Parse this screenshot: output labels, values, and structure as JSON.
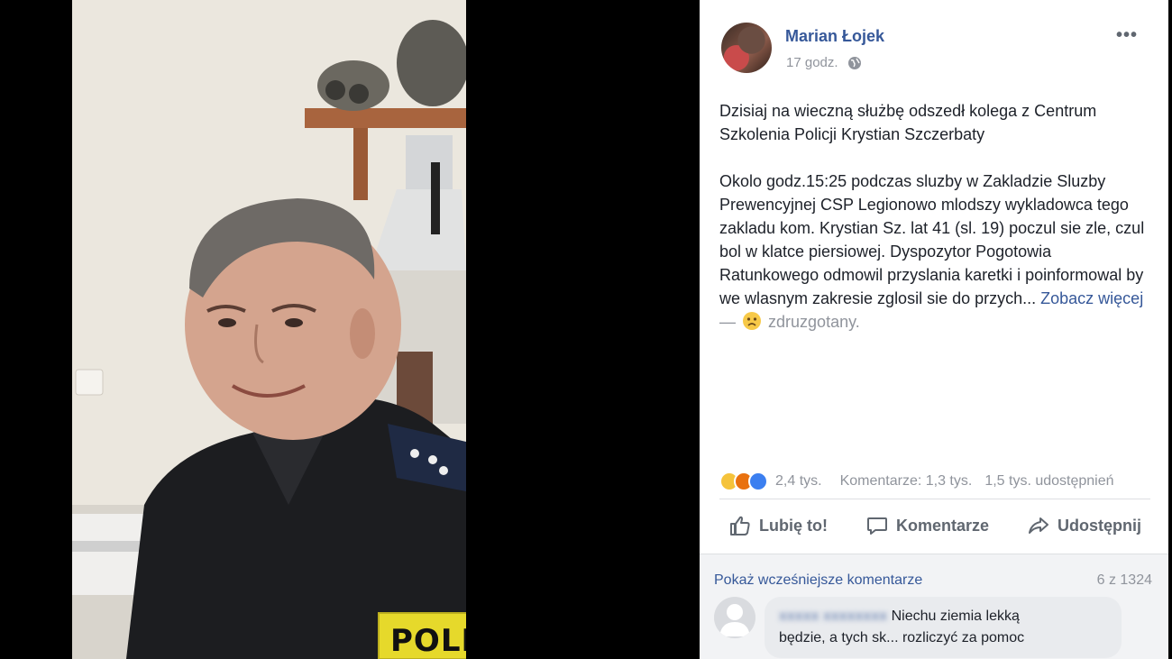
{
  "post": {
    "author": "Marian Łojek",
    "timestamp": "17 godz.",
    "privacy_icon": "globe-icon",
    "more_label": "•••",
    "text_paragraph_1": "Dzisiaj na wieczną służbę odszedł kolega z Centrum Szkolenia Policji Krystian Szczerbaty",
    "text_paragraph_2": "Okolo godz.15:25 podczas sluzby w Zakladzie Sluzby Prewencyjnej CSP Legionowo mlodszy wykladowca tego zakladu kom. Krystian Sz. lat 41 (sl. 19) poczul sie zle, czul bol w klatce piersiowej. Dyspozytor Pogotowia Ratunkowego odmowil przyslania karetki i poinformowal by we wlasnym zakresie zglosil sie do przych...",
    "see_more": "Zobacz więcej",
    "feeling_dash": "—",
    "feeling": "zdruzgotany."
  },
  "photo": {
    "badge_text": "POLIC"
  },
  "summary": {
    "reaction_icons": [
      "sad-icon",
      "angry-icon",
      "like-icon"
    ],
    "reaction_count": "2,4 tys.",
    "comments": "Komentarze: 1,3 tys.",
    "shares": "1,5 tys. udostępnień"
  },
  "actions": {
    "like": "Lubię to!",
    "comment": "Komentarze",
    "share": "Udostępnij"
  },
  "comments": {
    "previous_link": "Pokaż wcześniejsze komentarze",
    "count": "6 z 1324",
    "first": {
      "name": "xxxxx xxxxxxxx",
      "text_1": "Niechu ziemia lekką",
      "text_2": "będzie, a tych sk... rozliczyć za pomoc"
    }
  },
  "colors": {
    "link": "#365899",
    "muted": "#90949c",
    "background": "#000000"
  }
}
